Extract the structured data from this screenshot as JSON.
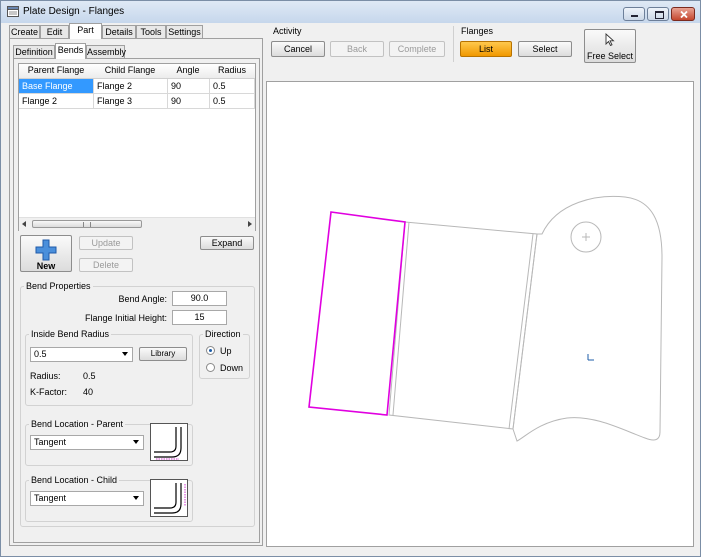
{
  "window": {
    "title": "Plate Design - Flanges"
  },
  "main_tabs": [
    {
      "label": "Create"
    },
    {
      "label": "Edit"
    },
    {
      "label": "Part"
    },
    {
      "label": "Details"
    },
    {
      "label": "Tools"
    },
    {
      "label": "Settings"
    }
  ],
  "sub_tabs": [
    {
      "label": "Definition"
    },
    {
      "label": "Bends"
    },
    {
      "label": "Assembly"
    }
  ],
  "bends_table": {
    "columns": [
      "Parent Flange",
      "Child Flange",
      "Angle",
      "Radius"
    ],
    "rows": [
      {
        "parent": "Base Flange",
        "child": "Flange 2",
        "angle": "90",
        "radius": "0.5",
        "selected": true
      },
      {
        "parent": "Flange 2",
        "child": "Flange 3",
        "angle": "90",
        "radius": "0.5",
        "selected": false
      }
    ]
  },
  "actions": {
    "new": "New",
    "update": "Update",
    "delete": "Delete",
    "expand": "Expand"
  },
  "bend_properties": {
    "group_label": "Bend Properties",
    "bend_angle_label": "Bend Angle:",
    "bend_angle_value": "90.0",
    "flange_height_label": "Flange Initial Height:",
    "flange_height_value": "15"
  },
  "inside_radius": {
    "group_label": "Inside Bend Radius",
    "selected": "0.5",
    "library_button": "Library",
    "radius_label": "Radius:",
    "radius_value": "0.5",
    "kfactor_label": "K-Factor:",
    "kfactor_value": "40"
  },
  "direction": {
    "group_label": "Direction",
    "up": "Up",
    "down": "Down",
    "selected": "Up"
  },
  "bend_location_parent": {
    "group_label": "Bend Location - Parent",
    "selected": "Tangent"
  },
  "bend_location_child": {
    "group_label": "Bend Location - Child",
    "selected": "Tangent"
  },
  "activity": {
    "label": "Activity",
    "cancel": "Cancel",
    "back": "Back",
    "complete": "Complete"
  },
  "flanges": {
    "label": "Flanges",
    "list": "List",
    "select": "Select",
    "free_select": "Free Select"
  },
  "colors": {
    "selected_flange": "#e000e0",
    "outline": "#b8b8b8",
    "accent_orange": "#f5a000",
    "selection_blue": "#3399ff",
    "axis_blue": "#1c5ca8"
  }
}
